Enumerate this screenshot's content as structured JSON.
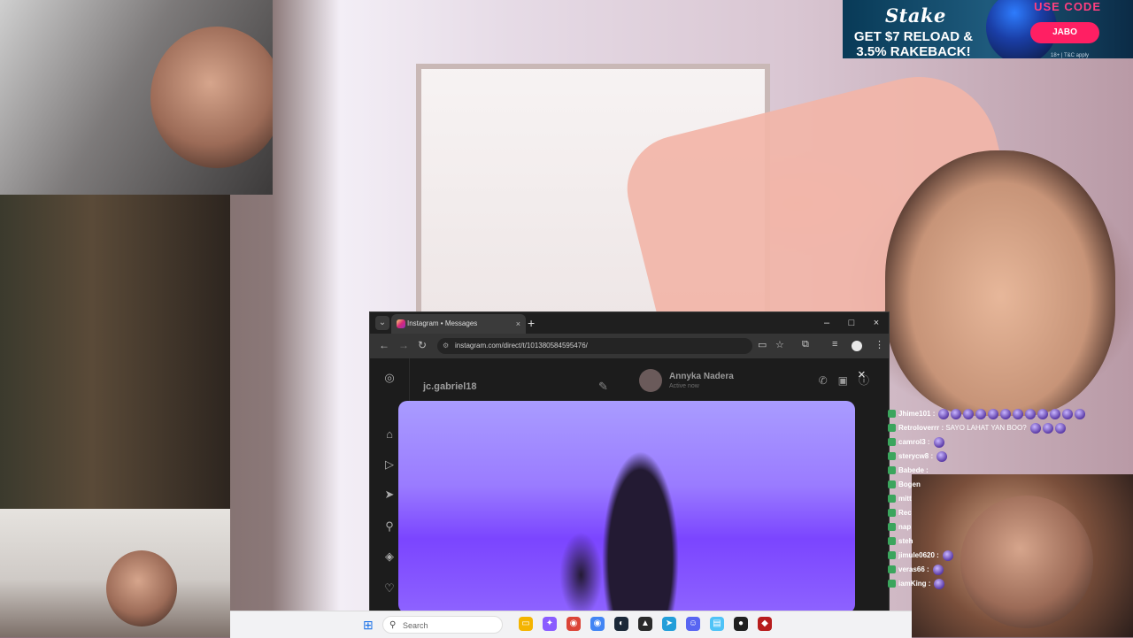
{
  "ad": {
    "brand": "Stake",
    "offer_line1": "GET $7 RELOAD &",
    "offer_line2": "3.5% RAKEBACK!",
    "use_code_label": "USE CODE",
    "code": "JABO",
    "fine_print": "18+ | T&C apply",
    "colors": {
      "background": "#083a57",
      "code_pill": "#ff1f63",
      "use_code_text": "#ff3f7f"
    }
  },
  "browser": {
    "tab_title": "Instagram • Messages",
    "new_tab_glyph": "+",
    "tab_close_glyph": "×",
    "menu_glyph": "⌄",
    "url": "instagram.com/direct/t/101380584595476/",
    "window_controls": {
      "minimize": "–",
      "maximize": "□",
      "close": "×"
    },
    "nav": {
      "back": "←",
      "forward": "→",
      "reload": "↻"
    },
    "toolbar_icons": [
      "cast-icon",
      "star-icon",
      "extensions-icon",
      "media-control-icon",
      "profile-avatar-icon",
      "more-icon"
    ]
  },
  "instagram": {
    "username": "jc.gabriel18",
    "peer_name": "Annyka Nadera",
    "peer_status": "Active now",
    "rail_icons": [
      "instagram-logo-icon",
      "home-icon",
      "reels-icon",
      "direct-icon",
      "search-icon",
      "explore-icon",
      "heart-icon"
    ],
    "header_icons": [
      "phone-icon",
      "video-icon",
      "info-icon"
    ],
    "viewer_close": "×"
  },
  "chat": {
    "messages": [
      {
        "user": "Jhime101 :",
        "text": "",
        "emotes": 12
      },
      {
        "user": "Retroloverrr :",
        "text": "SAYO LAHAT YAN BOO?",
        "emotes": 3
      },
      {
        "user": "camrol3 :",
        "text": "",
        "emotes": 1
      },
      {
        "user": "sterycw8 :",
        "text": "",
        "emotes": 1
      },
      {
        "user": "Babede :",
        "text": "",
        "emotes": 0
      },
      {
        "user": "Bogen",
        "text": "",
        "emotes": 0
      },
      {
        "user": "mitt",
        "text": "",
        "emotes": 0
      },
      {
        "user": "Rec",
        "text": "",
        "emotes": 0
      },
      {
        "user": "nap",
        "text": "",
        "emotes": 0
      },
      {
        "user": "steh",
        "text": "",
        "emotes": 0
      },
      {
        "user": "jimule0620 :",
        "text": "",
        "emotes": 1
      },
      {
        "user": "veras66 :",
        "text": "",
        "emotes": 1
      },
      {
        "user": "iamKing :",
        "text": "",
        "emotes": 1
      }
    ]
  },
  "taskbar": {
    "search_placeholder": "Search",
    "start_glyph": "⊞",
    "search_glyph": "⚲",
    "apps": [
      {
        "name": "file-explorer-icon",
        "color": "#f4b400",
        "glyph": "▭"
      },
      {
        "name": "copilot-icon",
        "color": "#8a5cff",
        "glyph": "✦"
      },
      {
        "name": "chrome-icon",
        "color": "#db4437",
        "glyph": "◉"
      },
      {
        "name": "chrome-profile-icon",
        "color": "#4285f4",
        "glyph": "◉"
      },
      {
        "name": "steam-icon",
        "color": "#1b2838",
        "glyph": "◐"
      },
      {
        "name": "epic-games-icon",
        "color": "#2a2a2a",
        "glyph": "▲"
      },
      {
        "name": "telegram-icon",
        "color": "#229ed9",
        "glyph": "➤"
      },
      {
        "name": "discord-icon",
        "color": "#5865f2",
        "glyph": "☺"
      },
      {
        "name": "notepad-icon",
        "color": "#4fc3f7",
        "glyph": "▤"
      },
      {
        "name": "obs-icon",
        "color": "#202020",
        "glyph": "●"
      },
      {
        "name": "dota-icon",
        "color": "#b71c1c",
        "glyph": "◆"
      }
    ]
  }
}
